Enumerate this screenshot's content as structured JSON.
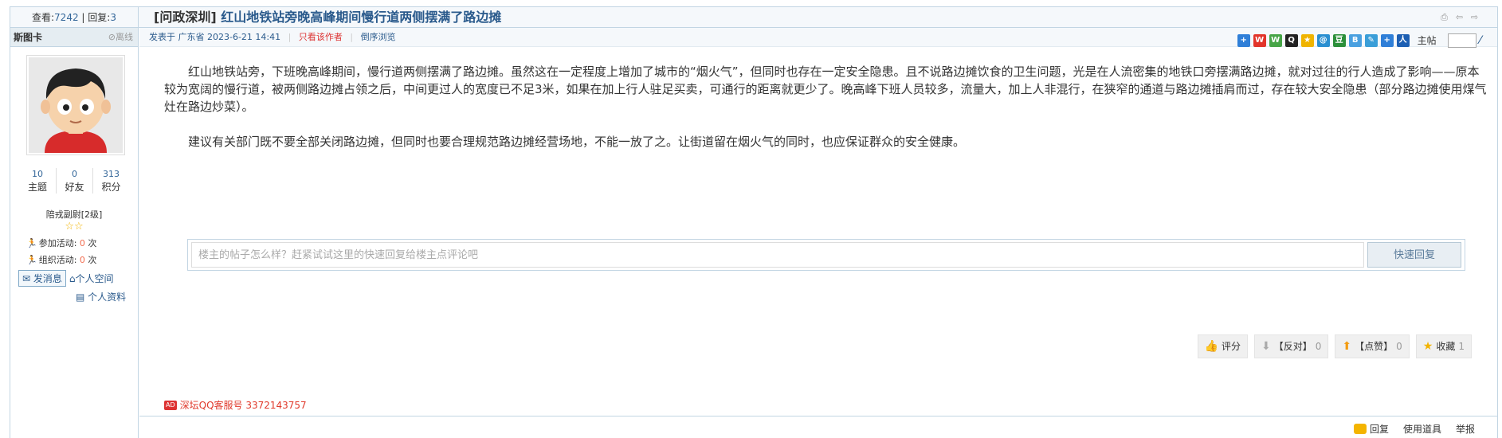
{
  "header": {
    "views_label": "查看:",
    "views": "7242",
    "sep": "|",
    "replies_label": "回复:",
    "replies": "3",
    "category": "[问政深圳]",
    "title": "红山地铁站旁晚高峰期间慢行道两侧摆满了路边摊"
  },
  "sidebar": {
    "username": "斯图卡",
    "status": "离线",
    "stats": [
      {
        "value": "10",
        "label": "主题"
      },
      {
        "value": "0",
        "label": "好友"
      },
      {
        "value": "313",
        "label": "积分"
      }
    ],
    "rank": "陪戎副尉[2级]",
    "activities": [
      {
        "label": "参加活动:",
        "count": "0",
        "unit": "次"
      },
      {
        "label": "组织活动:",
        "count": "0",
        "unit": "次"
      }
    ],
    "send_message": "发消息",
    "personal_space": "个人空间",
    "profile": "个人资料"
  },
  "meta": {
    "posted": "发表于 广东省 2023-6-21 14:41",
    "only_author": "只看该作者",
    "reverse": "倒序浏览",
    "floor": "主帖"
  },
  "content": {
    "paragraphs": [
      "红山地铁站旁，下班晚高峰期间，慢行道两侧摆满了路边摊。虽然这在一定程度上增加了城市的“烟火气”，但同时也存在一定安全隐患。且不说路边摊饮食的卫生问题，光是在人流密集的地铁口旁摆满路边摊，就对过往的行人造成了影响——原本较为宽阔的慢行道，被两侧路边摊占领之后，中间更过人的宽度已不足3米，如果在加上行人驻足买卖，可通行的距离就更少了。晚高峰下班人员较多，流量大，加上人非混行，在狭窄的通道与路边摊插肩而过，存在较大安全隐患（部分路边摊使用煤气灶在路边炒菜）。",
      "建议有关部门既不要全部关闭路边摊，但同时也要合理规范路边摊经营场地，不能一放了之。让街道留在烟火气的同时，也应保证群众的安全健康。"
    ]
  },
  "reply": {
    "placeholder": "楼主的帖子怎么样？赶紧试试这里的快速回复给楼主点评论吧",
    "button": "快速回复"
  },
  "actions": [
    {
      "label": "评分",
      "count": ""
    },
    {
      "label": "【反对】",
      "count": "0"
    },
    {
      "label": "【点赞】",
      "count": "0"
    },
    {
      "label": "收藏",
      "count": "1"
    }
  ],
  "ad": {
    "tag": "AD",
    "text": "深坛QQ客服号 3372143757"
  },
  "bottom": {
    "reply": "回复",
    "tools": "使用道具",
    "report": "举报"
  }
}
